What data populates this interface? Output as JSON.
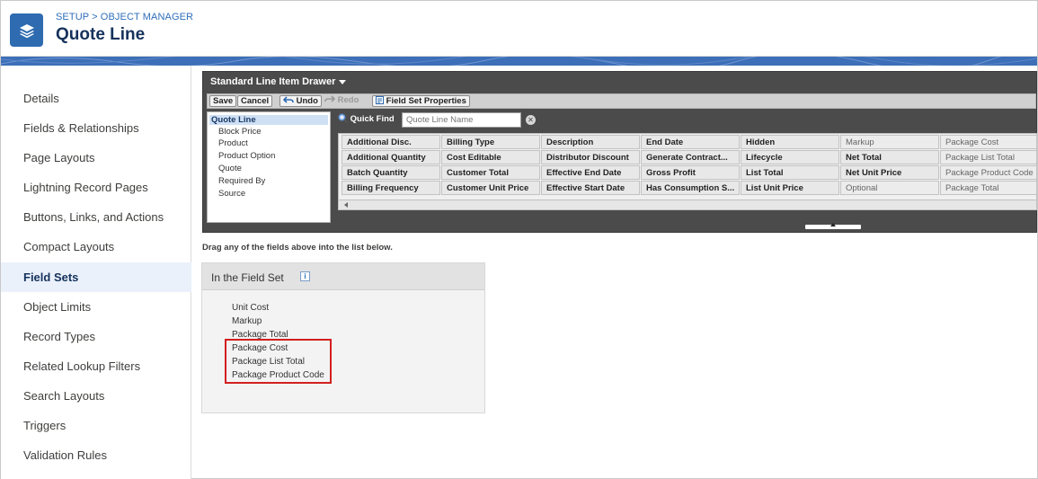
{
  "header": {
    "breadcrumb": "SETUP > OBJECT MANAGER",
    "title": "Quote Line",
    "icon": "layers-icon",
    "accent": "#2e6bb0"
  },
  "sidebar": {
    "items": [
      {
        "label": "Details"
      },
      {
        "label": "Fields & Relationships"
      },
      {
        "label": "Page Layouts"
      },
      {
        "label": "Lightning Record Pages"
      },
      {
        "label": "Buttons, Links, and Actions"
      },
      {
        "label": "Compact Layouts"
      },
      {
        "label": "Field Sets",
        "active": true
      },
      {
        "label": "Object Limits"
      },
      {
        "label": "Record Types"
      },
      {
        "label": "Related Lookup Filters"
      },
      {
        "label": "Search Layouts"
      },
      {
        "label": "Triggers"
      },
      {
        "label": "Validation Rules"
      }
    ]
  },
  "drawer": {
    "title": "Standard Line Item Drawer",
    "toolbar": {
      "save": "Save",
      "cancel": "Cancel",
      "undo": "Undo",
      "redo": "Redo",
      "properties": "Field Set Properties"
    },
    "objects": [
      "Quote Line",
      "Block Price",
      "Product",
      "Product Option",
      "Quote",
      "Required By",
      "Source"
    ],
    "quick_find_label": "Quick Find",
    "quick_find_placeholder": "Quote Line Name",
    "fields": [
      [
        "Additional Disc.",
        "Billing Type",
        "Description",
        "End Date",
        "Hidden",
        "Markup",
        "Package Cost"
      ],
      [
        "Additional Quantity",
        "Cost Editable",
        "Distributor Discount",
        "Generate Contract...",
        "Lifecycle",
        "Net Total",
        "Package List Total"
      ],
      [
        "Batch Quantity",
        "Customer Total",
        "Effective End Date",
        "Gross Profit",
        "List Total",
        "Net Unit Price",
        "Package Product Code"
      ],
      [
        "Billing Frequency",
        "Customer Unit Price",
        "Effective Start Date",
        "Has Consumption S...",
        "List Unit Price",
        "Optional",
        "Package Total"
      ]
    ]
  },
  "hint": "Drag any of the fields above into the list below.",
  "field_set": {
    "title": "In the Field Set",
    "items": [
      "Unit Cost",
      "Markup",
      "Package Total",
      "Package Cost",
      "Package List Total",
      "Package Product Code"
    ]
  }
}
